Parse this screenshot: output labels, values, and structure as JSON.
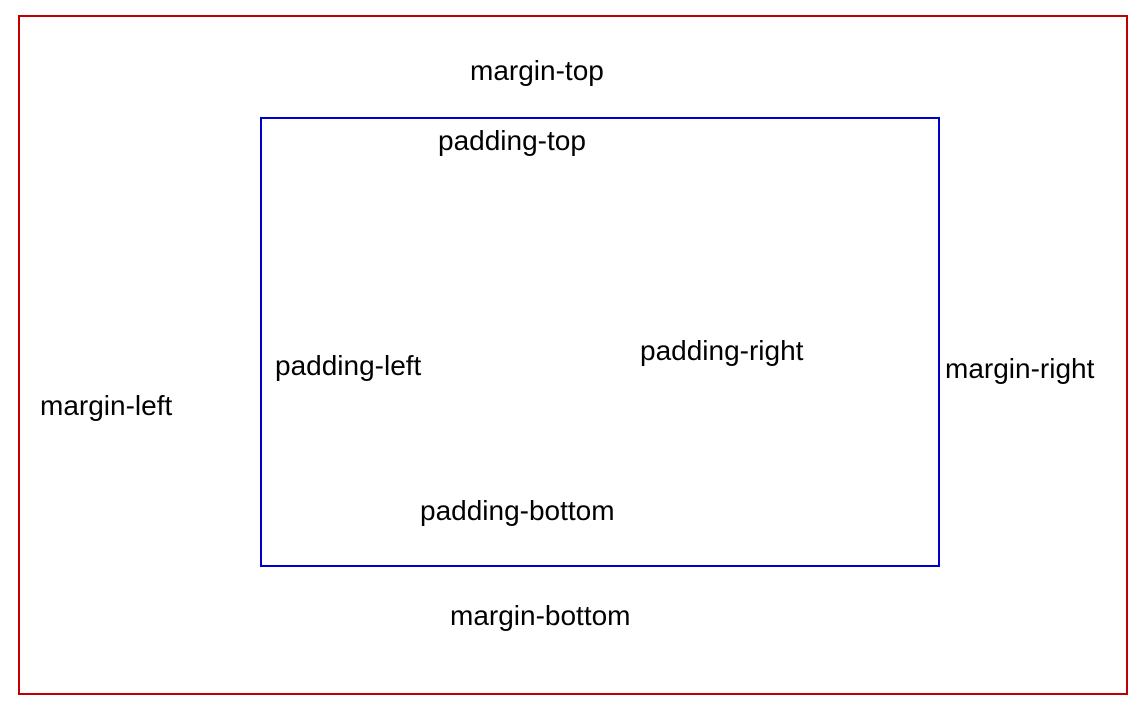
{
  "labels": {
    "marginTop": "margin-top",
    "marginLeft": "margin-left",
    "marginRight": "margin-right",
    "marginBottom": "margin-bottom",
    "paddingTop": "padding-top",
    "paddingLeft": "padding-left",
    "paddingRight": "padding-right",
    "paddingBottom": "padding-bottom"
  },
  "colors": {
    "outerBorder": "#c00000",
    "innerBorder": "#0000cc"
  }
}
